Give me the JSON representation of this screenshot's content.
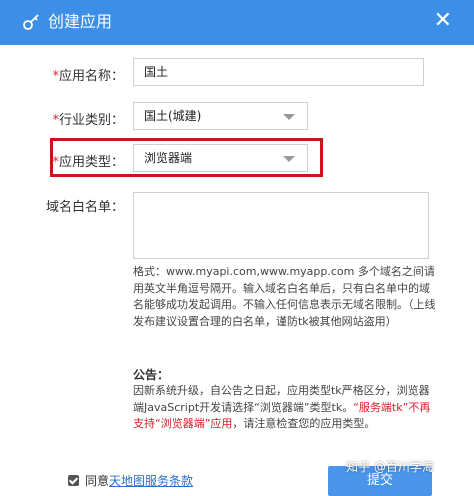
{
  "dialog": {
    "title": "创建应用",
    "close_symbol": "✕",
    "title_icon": "key-icon"
  },
  "form": {
    "app_name": {
      "required_mark": "*",
      "label": "应用名称：",
      "value": "国土"
    },
    "industry": {
      "required_mark": "*",
      "label": "行业类别：",
      "value": "国土(城建)"
    },
    "app_type": {
      "required_mark": "*",
      "label": "应用类型：",
      "value": "浏览器端"
    },
    "whitelist": {
      "label": "域名白名单：",
      "value": ""
    }
  },
  "hint_text": "格式：www.myapi.com,www.myapp.com 多个域名之间请用英文半角逗号隔开。输入域名白名单后，只有白名单中的域名能够成功发起调用。不输入任何信息表示无域名限制。（上线发布建议设置合理的白名单，谨防tk被其他网站盗用）",
  "notice": {
    "title": "公告：",
    "part1": "因新系统升级，自公告之日起，应用类型tk严格区分，浏览器端JavaScript开发请选择“浏览器端”类型tk。",
    "part2_red": "“服务端tk”不再支持“浏览器端”应用",
    "part3": "，请注意检查您的应用类型。"
  },
  "footer": {
    "agree_prefix": "同意",
    "agree_link": "天地图服务条款",
    "submit_label": "提交"
  },
  "watermark": "知乎 @百川学海",
  "colors": {
    "titlebar": "#3c8ee6",
    "highlight_border": "#c8161d",
    "required": "#e23333",
    "submit": "#4a95ea"
  }
}
